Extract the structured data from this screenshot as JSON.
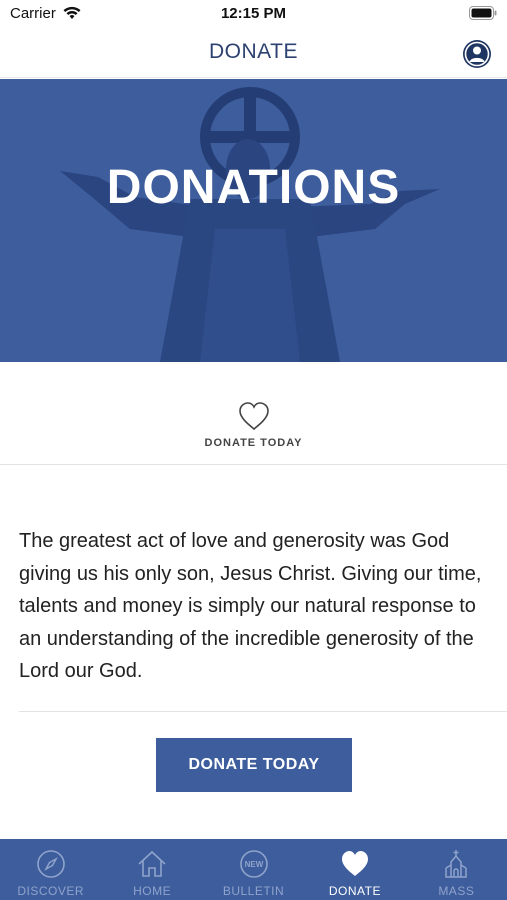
{
  "status_bar": {
    "carrier": "Carrier",
    "time": "12:15 PM"
  },
  "nav": {
    "title": "DONATE",
    "profile_icon": "profile-icon"
  },
  "hero": {
    "title": "DONATIONS",
    "background_color": "#3e5d9c"
  },
  "donate_section": {
    "icon": "heart-outline-icon",
    "label": "DONATE TODAY"
  },
  "intro": {
    "text": "The greatest act of love and generosity was God giving us his only son, Jesus Christ. Giving our time, talents and money is simply our natural response to an understanding of the incredible generosity of the Lord our God."
  },
  "donate_button": {
    "label": "DONATE TODAY",
    "color": "#3e5d9c"
  },
  "tabs": [
    {
      "label": "DISCOVER",
      "icon": "compass-icon",
      "active": false
    },
    {
      "label": "HOME",
      "icon": "home-icon",
      "active": false
    },
    {
      "label": "BULLETIN",
      "icon": "new-badge-icon",
      "badge": "NEW",
      "active": false
    },
    {
      "label": "DONATE",
      "icon": "heart-icon",
      "active": true
    },
    {
      "label": "MASS",
      "icon": "church-icon",
      "active": false
    }
  ]
}
